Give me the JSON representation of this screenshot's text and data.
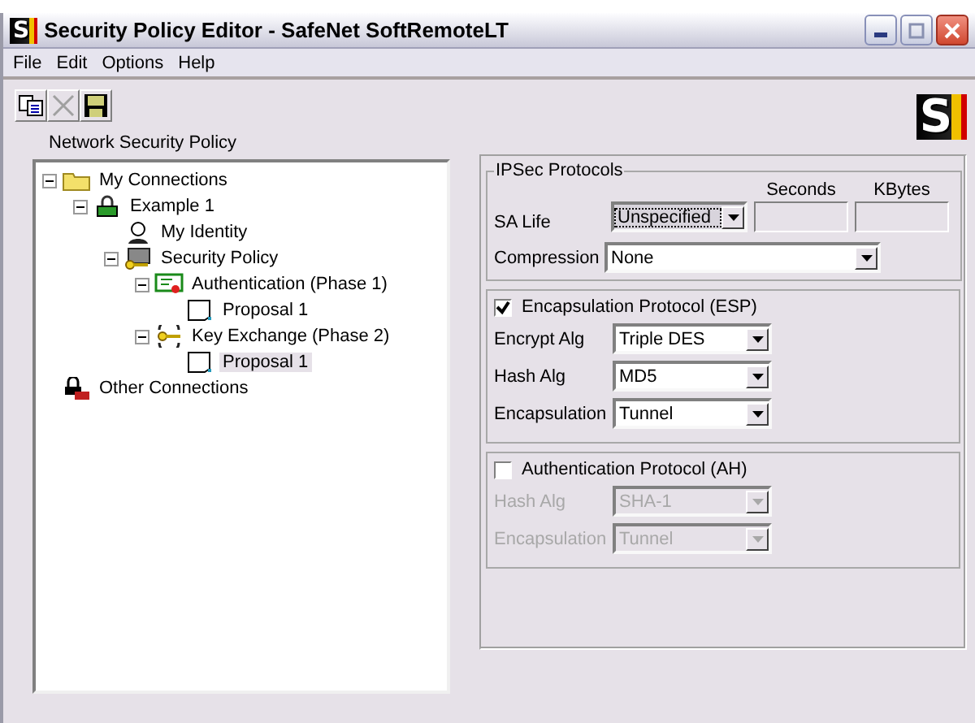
{
  "window": {
    "logo": "S",
    "title": "Security Policy Editor - SafeNet SoftRemoteLT"
  },
  "menu": [
    "File",
    "Edit",
    "Options",
    "Help"
  ],
  "toolbar": [
    {
      "kind": "copy",
      "disabled": false
    },
    {
      "kind": "delete",
      "disabled": true
    },
    {
      "kind": "save",
      "disabled": false
    }
  ],
  "brand_logo": "S",
  "tree": {
    "label": "Network Security Policy",
    "items": [
      {
        "label": "My Connections",
        "kind": "folder",
        "expanded": true,
        "selected": false,
        "children": [
          {
            "label": "Example 1",
            "kind": "connection",
            "expanded": true,
            "selected": false,
            "children": [
              {
                "label": "My Identity",
                "kind": "identity",
                "selected": false
              },
              {
                "label": "Security Policy",
                "kind": "policy",
                "expanded": true,
                "selected": false,
                "children": [
                  {
                    "label": "Authentication (Phase 1)",
                    "kind": "certificate",
                    "expanded": true,
                    "selected": false,
                    "children": [
                      {
                        "label": "Proposal 1",
                        "kind": "proposal",
                        "selected": false
                      }
                    ]
                  },
                  {
                    "label": "Key Exchange (Phase 2)",
                    "kind": "keys",
                    "expanded": true,
                    "selected": false,
                    "children": [
                      {
                        "label": "Proposal 1",
                        "kind": "proposal",
                        "selected": true
                      }
                    ]
                  }
                ]
              }
            ]
          }
        ]
      },
      {
        "label": "Other Connections",
        "kind": "other",
        "selected": false
      }
    ]
  },
  "ipsec": {
    "title": "IPSec Protocols",
    "sa_life": {
      "label": "SA Life",
      "value": "Unspecified",
      "seconds_label": "Seconds",
      "kbytes_label": "KBytes",
      "disabled": true
    },
    "compression": {
      "label": "Compression",
      "value": "None"
    },
    "protocols": [
      {
        "label": "Encapsulation Protocol (ESP)",
        "checked": true,
        "fields": [
          {
            "label": "Encrypt Alg",
            "value": "Triple DES"
          },
          {
            "label": "Hash Alg",
            "value": "MD5"
          },
          {
            "label": "Encapsulation",
            "value": "Tunnel"
          }
        ]
      },
      {
        "label": "Authentication Protocol (AH)",
        "checked": false,
        "fields": [
          {
            "label": "Hash Alg",
            "value": "SHA-1"
          },
          {
            "label": "Encapsulation",
            "value": "Tunnel"
          }
        ]
      }
    ]
  }
}
